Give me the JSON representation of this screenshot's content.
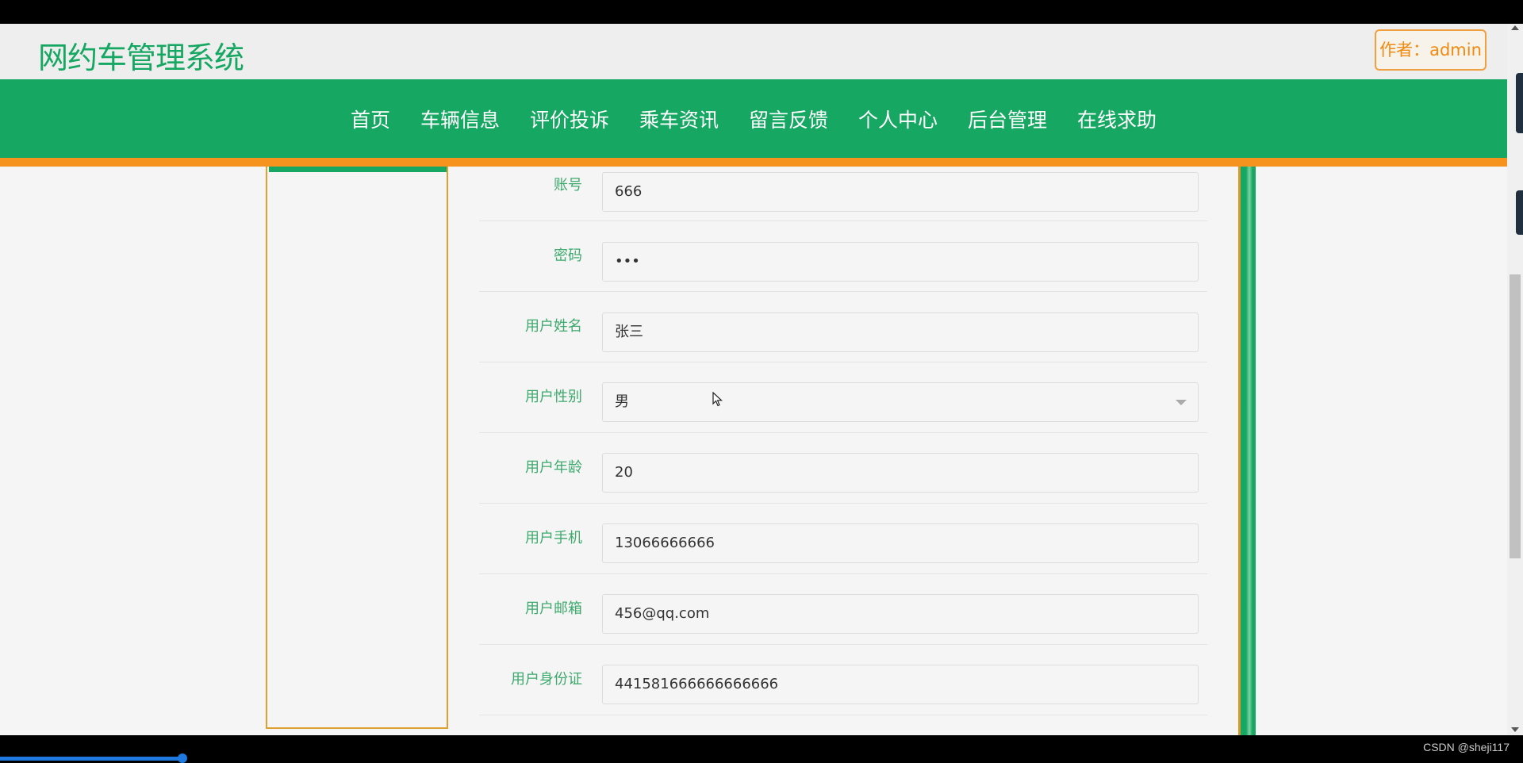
{
  "header": {
    "logo": "网约车管理系统",
    "author": "作者：admin"
  },
  "nav": {
    "items": [
      "首页",
      "车辆信息",
      "评价投诉",
      "乘车资讯",
      "留言反馈",
      "个人中心",
      "后台管理",
      "在线求助"
    ]
  },
  "form": {
    "rows": [
      {
        "label": "账号",
        "value": "666"
      },
      {
        "label": "密码",
        "value": "•••"
      },
      {
        "label": "用户姓名",
        "value": "张三"
      },
      {
        "label": "用户性别",
        "value": "男"
      },
      {
        "label": "用户年龄",
        "value": "20"
      },
      {
        "label": "用户手机",
        "value": "13066666666"
      },
      {
        "label": "用户邮箱",
        "value": "456@qq.com"
      },
      {
        "label": "用户身份证",
        "value": "441581666666666666"
      }
    ]
  },
  "video": {
    "progress_fraction": 0.12,
    "watermark": "CSDN @sheji117"
  },
  "colors": {
    "brand_green": "#16a862",
    "accent_orange": "#f6921e"
  }
}
